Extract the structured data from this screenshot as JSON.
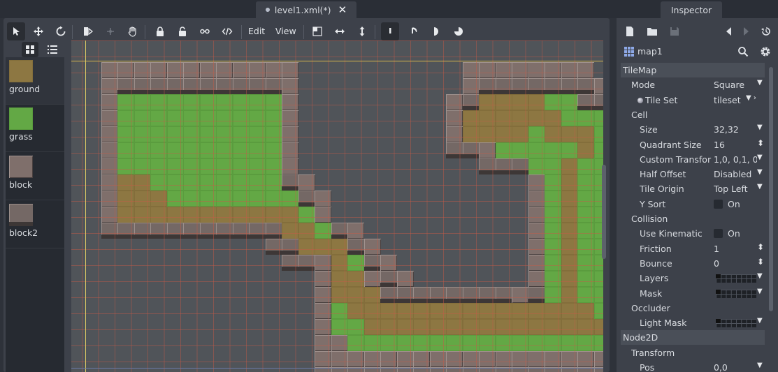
{
  "editor": {
    "tab_title": "level1.xml(*)",
    "inspector_tab": "Inspector",
    "toolbar": {
      "edit_menu": "Edit",
      "view_menu": "View"
    }
  },
  "palette": {
    "items": [
      {
        "label": "ground",
        "color": "#8d7742"
      },
      {
        "label": "grass",
        "color": "#63a845"
      },
      {
        "label": "block",
        "color": "#7f6f6b"
      },
      {
        "label": "block2",
        "color": "#746865"
      }
    ]
  },
  "tilemap": {
    "legend": {
      "B": "block",
      "b": "block2",
      "G": "grass",
      "D": "ground"
    },
    "rows": [
      ".BBBBBBBBBBBB..........BBBBBBBB..",
      ".BbbbbbbbbbbB..........BbbbbbbbB.",
      ".BGGGGGGGGGGB.........BbDDDDGGbbb",
      ".BGGGGGGGGGGB.........BDDDDDDGGGG",
      ".BGGGGGGGGGGB.........BDDDDGDDDGG",
      ".BGGGGGGGGGGB.........bbBGGGGGDGG",
      ".BGGGGGGGGGGB...........bbbGGDGGG",
      ".BDDGGGGGGGGbB.............BGDGGG",
      ".BDDDGGGGGGGGbB............BGDGGG",
      ".BDDDDDDDDDDDGB............BGDGGG",
      ".bbbbbbbbbbbDDGbB..........BGDGGG",
      "...........bbDDDbB.........BGDGGG",
      "............bbBDGbB........BGDGGG",
      "..............BDDBbB.......BGDGGG",
      "..............BDDDbbbbbbbbBbGDGGG",
      "..............BGDDDDDDDDDDDDDDDGG",
      "..............BGGDDDDDDDDDDDDDDDG",
      "..............BBGGGGGGGGGGGGGGGGG",
      "..............BBBBBBBBBBBBBBBBBBB",
      "..............bbbbbbbbbbbbbbbbbbb"
    ]
  },
  "inspector": {
    "node_name": "map1",
    "sections": [
      {
        "kind": "sect",
        "label": "TileMap"
      },
      {
        "kind": "prop",
        "indent": 1,
        "label": "Mode",
        "value": "Square",
        "control": "dropdown"
      },
      {
        "kind": "prop",
        "indent": 1,
        "label": "Tile Set",
        "value": "tileset",
        "control": "resource"
      },
      {
        "kind": "cat",
        "indent": 1,
        "label": "Cell"
      },
      {
        "kind": "prop",
        "indent": 2,
        "label": "Size",
        "value": "32,32",
        "control": "dropdown"
      },
      {
        "kind": "prop",
        "indent": 2,
        "label": "Quadrant Size",
        "value": "16",
        "control": "spin"
      },
      {
        "kind": "prop",
        "indent": 2,
        "label": "Custom Transfor",
        "value": "1,0, 0,1, 0,0",
        "control": "dropdown"
      },
      {
        "kind": "prop",
        "indent": 2,
        "label": "Half Offset",
        "value": "Disabled",
        "control": "dropdown"
      },
      {
        "kind": "prop",
        "indent": 2,
        "label": "Tile Origin",
        "value": "Top Left",
        "control": "dropdown"
      },
      {
        "kind": "prop",
        "indent": 2,
        "label": "Y Sort",
        "value": "On",
        "control": "check"
      },
      {
        "kind": "cat",
        "indent": 1,
        "label": "Collision"
      },
      {
        "kind": "prop",
        "indent": 2,
        "label": "Use Kinematic",
        "value": "On",
        "control": "check"
      },
      {
        "kind": "prop",
        "indent": 2,
        "label": "Friction",
        "value": "1",
        "control": "spin"
      },
      {
        "kind": "prop",
        "indent": 2,
        "label": "Bounce",
        "value": "0",
        "control": "spin"
      },
      {
        "kind": "prop",
        "indent": 2,
        "label": "Layers",
        "value": "",
        "control": "layers"
      },
      {
        "kind": "prop",
        "indent": 2,
        "label": "Mask",
        "value": "",
        "control": "layers"
      },
      {
        "kind": "cat",
        "indent": 1,
        "label": "Occluder"
      },
      {
        "kind": "prop",
        "indent": 2,
        "label": "Light Mask",
        "value": "",
        "control": "layers"
      },
      {
        "kind": "sect",
        "label": "Node2D"
      },
      {
        "kind": "cat",
        "indent": 1,
        "label": "Transform"
      },
      {
        "kind": "prop",
        "indent": 2,
        "label": "Pos",
        "value": "0,0",
        "control": "dropdown"
      }
    ]
  }
}
